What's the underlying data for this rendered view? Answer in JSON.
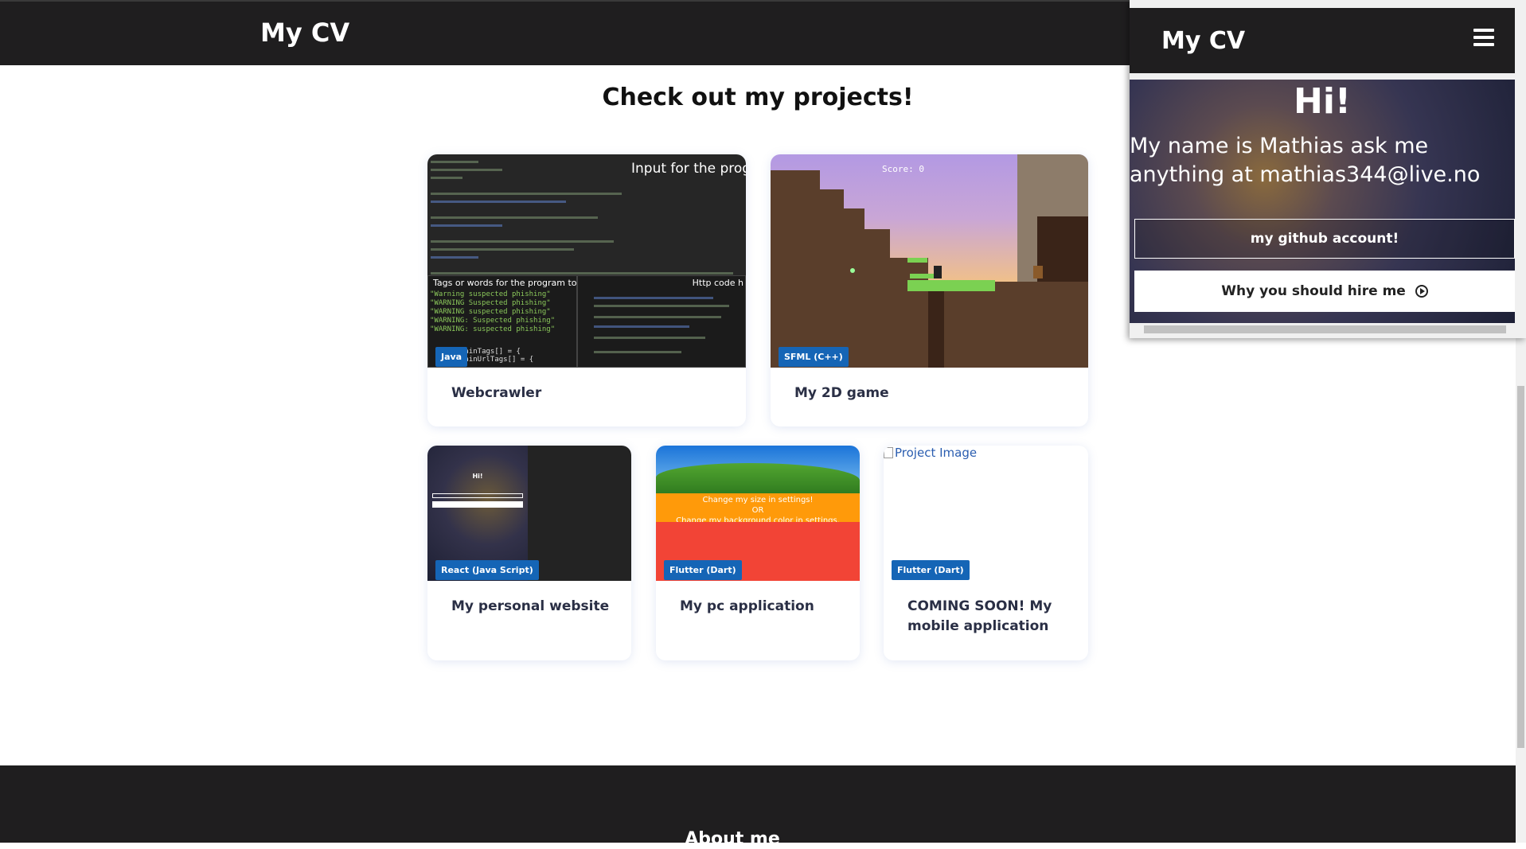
{
  "header": {
    "brand": "My CV"
  },
  "projects_section": {
    "title": "Check out my projects!"
  },
  "projects": [
    {
      "title": "Webcrawler",
      "tag": "Java",
      "thumb_text": {
        "input_caption": "Input for the prog",
        "tags_caption": "Tags or words for the program to detect",
        "http_caption": "Http code h",
        "code_lines": [
          "\"Warning suspected phishing\"",
          "\"WARNING Suspected phishing\"",
          "\"WARNING suspected phishing\"",
          "\"WARNING: Suspected phishing\"",
          "\"WARNING: suspected phishing\""
        ],
        "bottom_lines": [
          "mainTags[] = {",
          "mainUrlTags[] = {"
        ]
      }
    },
    {
      "title": "My 2D game",
      "tag": "SFML (C++)",
      "thumb_text": {
        "score": "Score: 0"
      }
    },
    {
      "title": "My personal website",
      "tag": "React (Java Script)",
      "thumb_text": {
        "hi": "Hi!"
      }
    },
    {
      "title": "My pc application",
      "tag": "Flutter (Dart)",
      "thumb_text": {
        "line1": "Change my size in settings!",
        "line2": "OR",
        "line3": "Change my background color in settings."
      }
    },
    {
      "title": "COMING SOON! My mobile application",
      "tag": "Flutter (Dart)",
      "broken_image_alt": "Project Image"
    }
  ],
  "popup": {
    "brand": "My CV",
    "hero_title": "Hi!",
    "intro": "My name is Mathias ask me anything at mathias344@live.no",
    "github_button": "my github account!",
    "hire_button": "Why you should hire me"
  },
  "footer": {
    "heading": "About me"
  },
  "colors": {
    "header_bg": "#1f1e1f",
    "tag_bg": "#1565b6",
    "card_shadow": "#6482c8"
  }
}
